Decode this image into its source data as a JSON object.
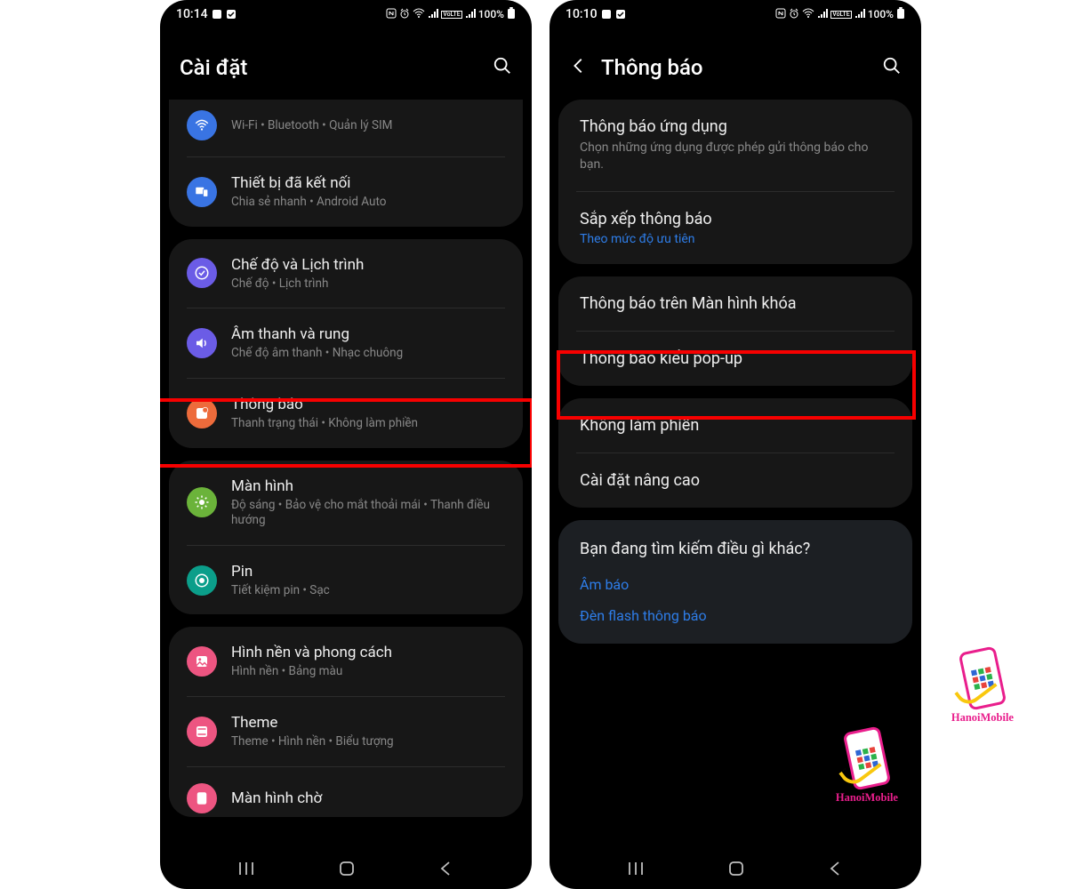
{
  "left": {
    "statusbar": {
      "time": "10:14",
      "battery": "100%"
    },
    "title": "Cài đặt",
    "group1": [
      {
        "title": "",
        "sub": "Wi-Fi  •  Bluetooth  •  Quản lý SIM",
        "color": "c-blue",
        "icon": "wifi"
      },
      {
        "title": "Thiết bị đã kết nối",
        "sub": "Chia sẻ nhanh  •  Android Auto",
        "color": "c-bluel",
        "icon": "devices"
      }
    ],
    "group2": [
      {
        "title": "Chế độ và Lịch trình",
        "sub": "Chế độ  •  Lịch trình",
        "color": "c-purple",
        "icon": "check"
      },
      {
        "title": "Âm thanh và rung",
        "sub": "Chế độ âm thanh  •  Nhạc chuông",
        "color": "c-vol",
        "icon": "sound"
      },
      {
        "title": "Thông báo",
        "sub": "Thanh trạng thái  •  Không làm phiền",
        "color": "c-orange",
        "icon": "notif",
        "highlight": true
      }
    ],
    "group3": [
      {
        "title": "Màn hình",
        "sub": "Độ sáng  •  Bảo vệ cho mắt thoải mái  •  Thanh điều hướng",
        "color": "c-green",
        "icon": "display"
      },
      {
        "title": "Pin",
        "sub": "Tiết kiệm pin  •  Sạc",
        "color": "c-teal",
        "icon": "battery"
      }
    ],
    "group4": [
      {
        "title": "Hình nền và phong cách",
        "sub": "Hình nền  •  Bảng màu",
        "color": "c-pink",
        "icon": "wallpaper"
      },
      {
        "title": "Theme",
        "sub": "Theme  •  Hình nền  •  Biểu tượng",
        "color": "c-pink2",
        "icon": "theme"
      },
      {
        "title": "Màn hình chờ",
        "sub": "",
        "color": "c-pink2",
        "icon": "standby"
      }
    ]
  },
  "right": {
    "statusbar": {
      "time": "10:10",
      "battery": "100%"
    },
    "title": "Thông báo",
    "card1": [
      {
        "title": "Thông báo ứng dụng",
        "sub": "Chọn những ứng dụng được phép gửi thông báo cho bạn."
      },
      {
        "title": "Sắp xếp thông báo",
        "link": "Theo mức độ ưu tiên"
      }
    ],
    "card2": [
      {
        "title": "Thông báo trên Màn hình khóa"
      },
      {
        "title": "Thông báo kiểu pop-up",
        "highlight": true
      }
    ],
    "card3": [
      {
        "title": "Không làm phiền"
      },
      {
        "title": "Cài đặt nâng cao"
      }
    ],
    "search": {
      "heading": "Bạn đang tìm kiếm điều gì khác?",
      "links": [
        "Âm báo",
        "Đèn flash thông báo"
      ]
    }
  },
  "logo": "HanoiMobile"
}
